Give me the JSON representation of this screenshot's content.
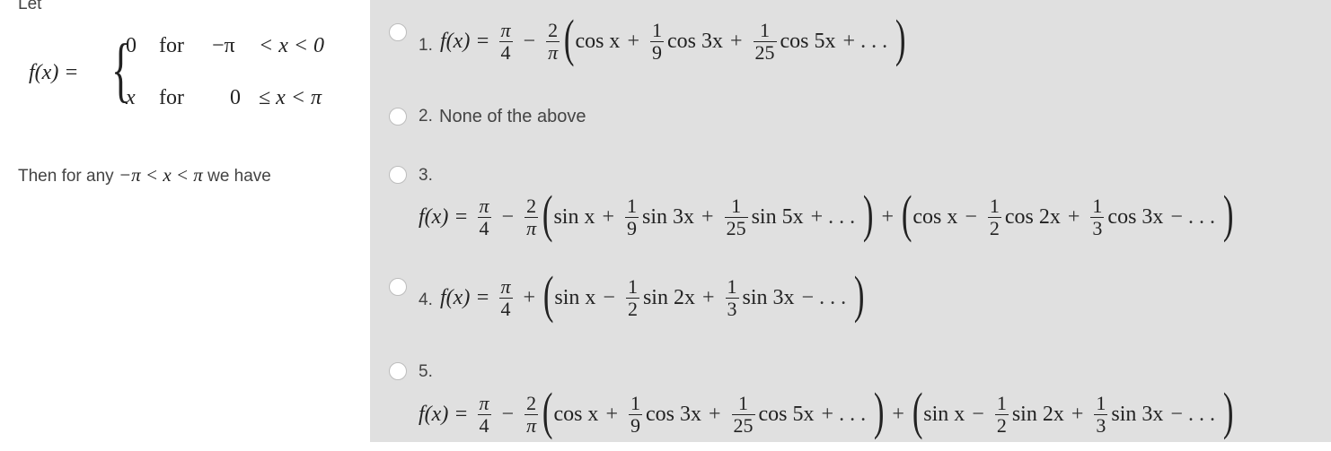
{
  "question": {
    "intro": "Let",
    "piecewise": {
      "lhs": "f(x) =",
      "rows": [
        {
          "value": "0",
          "word": "for",
          "lower": "−π",
          "condition": "< x < 0"
        },
        {
          "value": "x",
          "word": "for",
          "lower": "0",
          "condition": "≤ x < π"
        }
      ]
    },
    "then_text": "Then for any",
    "then_math": "−π < x < π",
    "then_suffix": "we have"
  },
  "options": [
    {
      "number": "1.",
      "selected": false,
      "lhs": "f(x) =",
      "parts": {
        "f1n": "π",
        "f1d": "4",
        "op1": "−",
        "f2n": "2",
        "f2d": "π",
        "t1": "cos x",
        "op2": "+",
        "c1n": "1",
        "c1d": "9",
        "t2": "cos 3x",
        "op3": "+",
        "c2n": "1",
        "c2d": "25",
        "t3": "cos 5x",
        "tail": "+ . . ."
      }
    },
    {
      "number": "2.",
      "selected": false,
      "text": "None of the above"
    },
    {
      "number": "3.",
      "selected": false,
      "lhs": "f(x) =",
      "parts": {
        "f1n": "π",
        "f1d": "4",
        "op1": "−",
        "f2n": "2",
        "f2d": "π",
        "t1": "sin x",
        "op2": "+",
        "c1n": "1",
        "c1d": "9",
        "t2": "sin 3x",
        "op3": "+",
        "c2n": "1",
        "c2d": "25",
        "t3": "sin 5x",
        "tail": "+ . . .",
        "join": "+",
        "u1": "cos x",
        "uop1": "−",
        "d1n": "1",
        "d1d": "2",
        "u2": "cos 2x",
        "uop2": "+",
        "d2n": "1",
        "d2d": "3",
        "u3": "cos 3x",
        "utail": "− . . ."
      }
    },
    {
      "number": "4.",
      "selected": false,
      "lhs": "f(x) =",
      "parts": {
        "f1n": "π",
        "f1d": "4",
        "op1": "+",
        "t1": "sin x",
        "op2": "−",
        "c1n": "1",
        "c1d": "2",
        "t2": "sin 2x",
        "op3": "+",
        "c2n": "1",
        "c2d": "3",
        "t3": "sin 3x",
        "tail": "− . . ."
      }
    },
    {
      "number": "5.",
      "selected": false,
      "lhs": "f(x) =",
      "parts": {
        "f1n": "π",
        "f1d": "4",
        "op1": "−",
        "f2n": "2",
        "f2d": "π",
        "t1": "cos x",
        "op2": "+",
        "c1n": "1",
        "c1d": "9",
        "t2": "cos 3x",
        "op3": "+",
        "c2n": "1",
        "c2d": "25",
        "t3": "cos 5x",
        "tail": "+ . . .",
        "join": "+",
        "u1": "sin x",
        "uop1": "−",
        "d1n": "1",
        "d1d": "2",
        "u2": "sin 2x",
        "uop2": "+",
        "d2n": "1",
        "d2d": "3",
        "u3": "sin 3x",
        "utail": "− . . ."
      }
    }
  ],
  "colors": {
    "options_background": "#e0e0e0",
    "radio_fill": "#ffffff",
    "radio_border": "#bdbdbd",
    "text": "#444444"
  }
}
